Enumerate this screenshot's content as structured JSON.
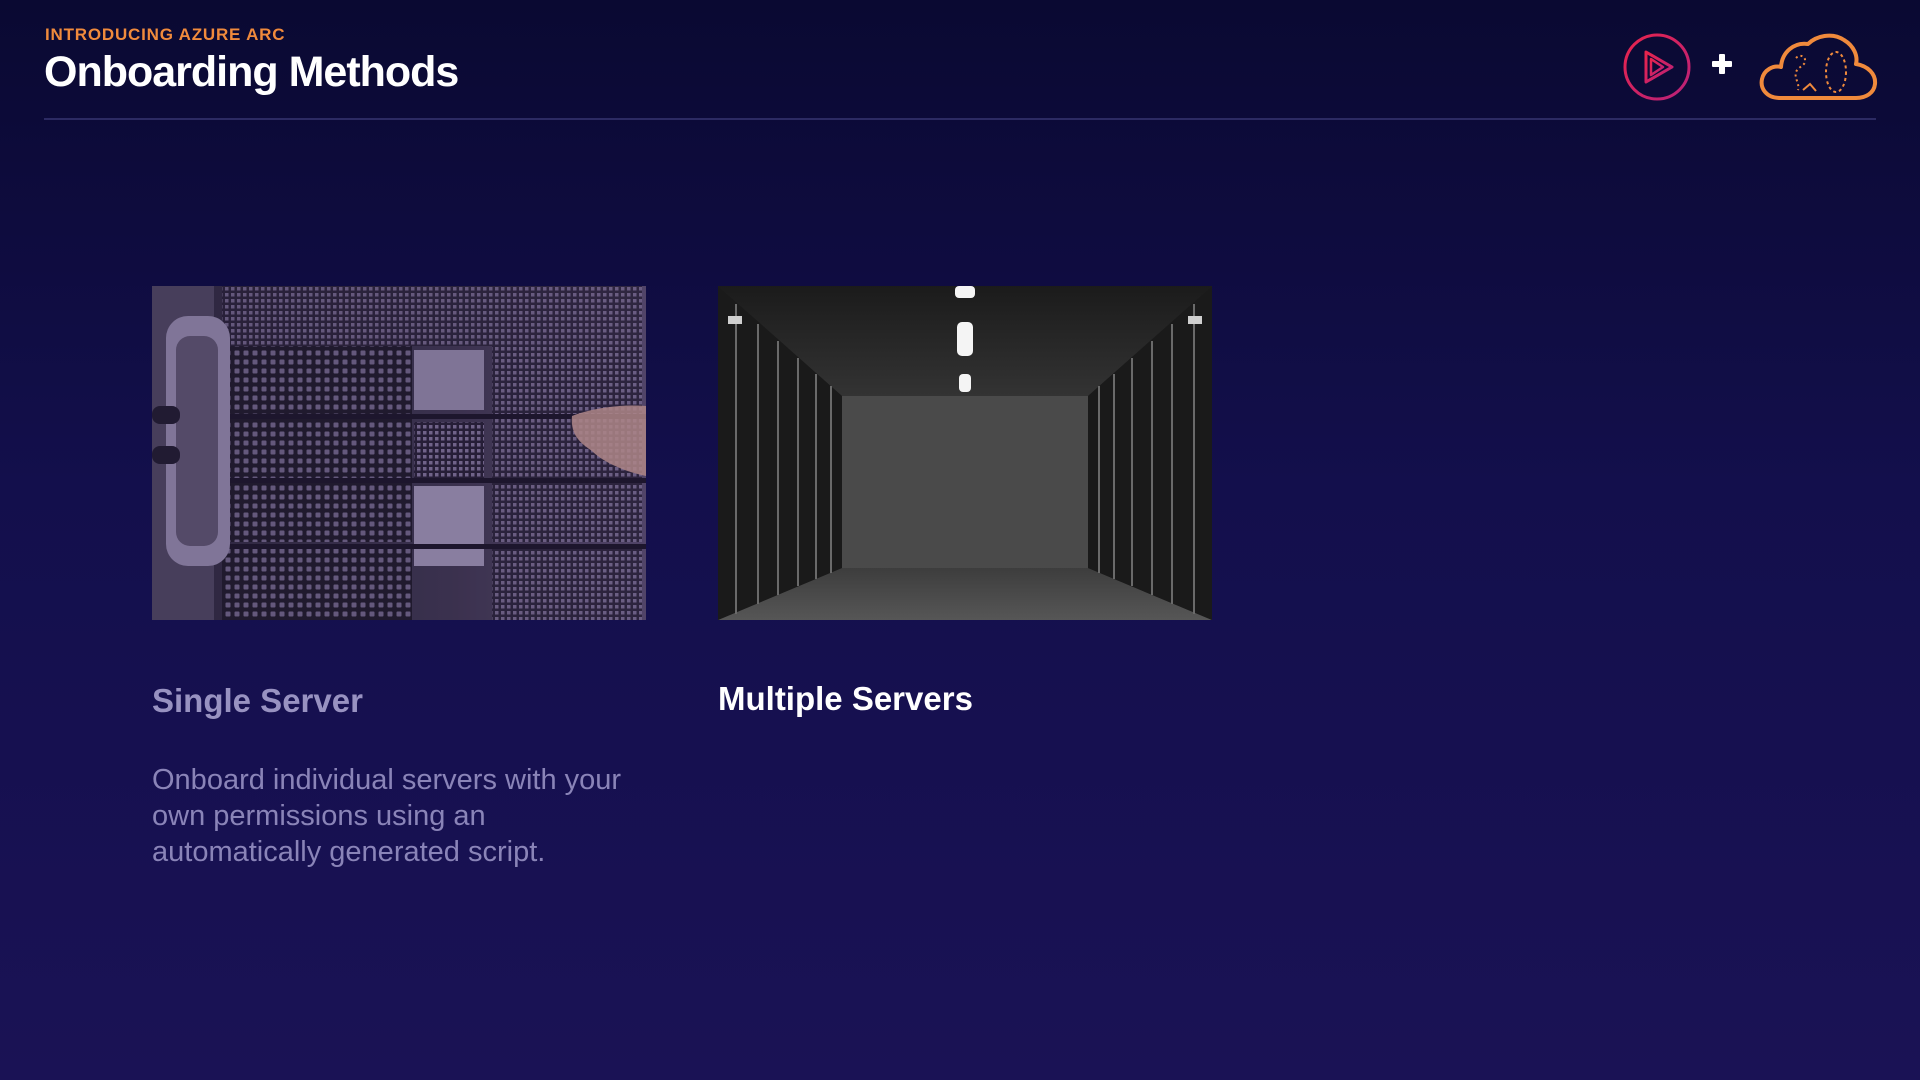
{
  "slide": {
    "eyebrow": "INTRODUCING AZURE ARC",
    "title": "Onboarding Methods"
  },
  "header_logos": [
    {
      "icon": "play-logo-icon",
      "color": "#e8244c"
    },
    {
      "icon": "plus-icon",
      "color": "#ffffff"
    },
    {
      "icon": "cloud-logo-icon",
      "color": "#f08a3c"
    }
  ],
  "cards": [
    {
      "title": "Single Server",
      "description": "Onboard individual servers with your own permissions using an automatically generated script.",
      "image": "server-rack-photo"
    },
    {
      "title": "Multiple Servers",
      "image": "server-room-photo"
    }
  ],
  "colors": {
    "accent": "#f08a3c",
    "brand_red": "#e8244c",
    "background_top": "#0a0932",
    "background_bottom": "#1a1255"
  }
}
